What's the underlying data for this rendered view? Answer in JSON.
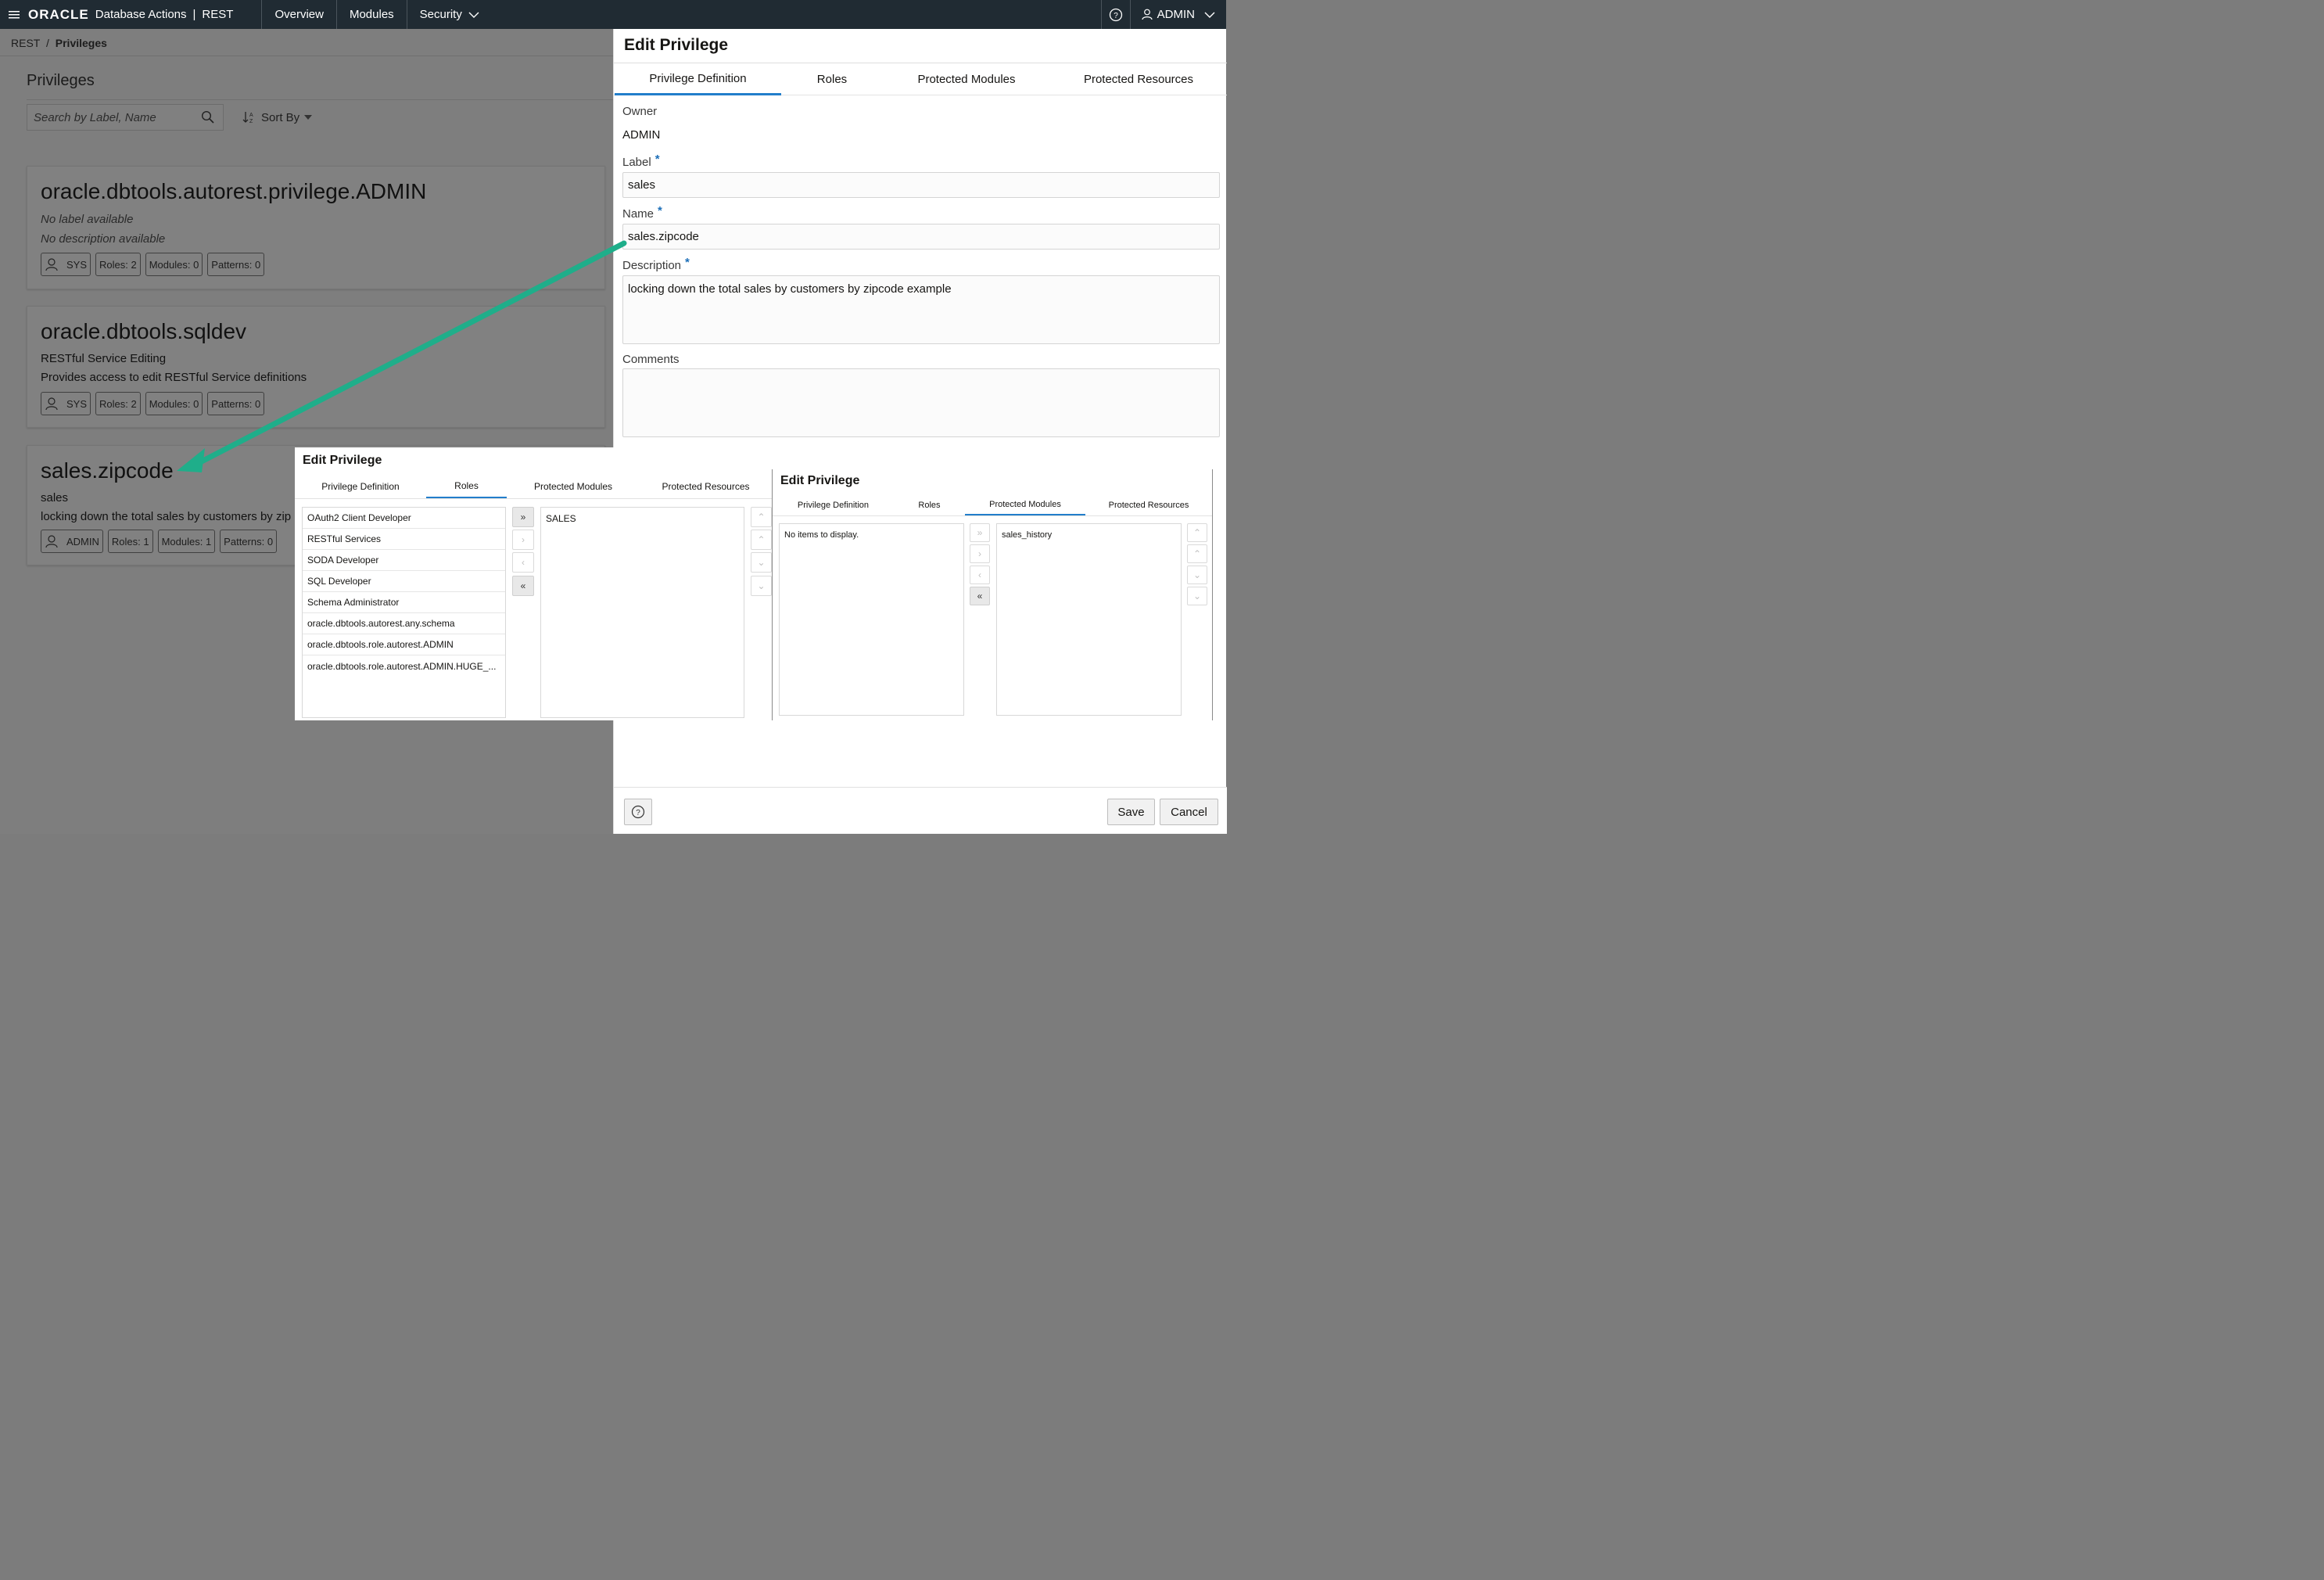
{
  "header": {
    "brand": "ORACLE",
    "app": "Database Actions",
    "separator": "|",
    "section": "REST",
    "nav": [
      "Overview",
      "Modules",
      "Security"
    ],
    "user": "ADMIN",
    "bg_color": "#202b33"
  },
  "breadcrumb": {
    "root": "REST",
    "sep": "/",
    "current": "Privileges"
  },
  "page": {
    "title": "Privileges",
    "search_placeholder": "Search by Label, Name",
    "sort_label": "Sort By"
  },
  "cards": [
    {
      "title": "oracle.dbtools.autorest.privilege.ADMIN",
      "label": "No label available",
      "description": "No description available",
      "owner": "SYS",
      "roles": "Roles: 2",
      "modules": "Modules: 0",
      "patterns": "Patterns: 0"
    },
    {
      "title": "oracle.dbtools.sqldev",
      "label": "RESTful Service Editing",
      "description": "Provides access to edit RESTful Service definitions",
      "owner": "SYS",
      "roles": "Roles: 2",
      "modules": "Modules: 0",
      "patterns": "Patterns: 0"
    },
    {
      "title": "sales.zipcode",
      "label": "sales",
      "description": "locking down the total sales by customers by zipc",
      "owner": "ADMIN",
      "roles": "Roles: 1",
      "modules": "Modules: 1",
      "patterns": "Patterns: 0"
    }
  ],
  "drawer": {
    "title": "Edit Privilege",
    "tabs": [
      "Privilege Definition",
      "Roles",
      "Protected Modules",
      "Protected Resources"
    ],
    "active_tab": "Privilege Definition",
    "owner_label": "Owner",
    "owner_value": "ADMIN",
    "label_label": "Label",
    "label_value": "sales",
    "name_label": "Name",
    "name_value": "sales.zipcode",
    "description_label": "Description",
    "description_value": "locking down the total sales by customers by zipcode example",
    "comments_label": "Comments",
    "comments_value": "",
    "required_mark": "*",
    "save_label": "Save",
    "cancel_label": "Cancel"
  },
  "roles_dialog": {
    "title": "Edit Privilege",
    "tabs": [
      "Privilege Definition",
      "Roles",
      "Protected Modules",
      "Protected Resources"
    ],
    "active_tab": "Roles",
    "available": [
      "OAuth2 Client Developer",
      "RESTful Services",
      "SODA Developer",
      "SQL Developer",
      "Schema Administrator",
      "oracle.dbtools.autorest.any.schema",
      "oracle.dbtools.role.autorest.ADMIN",
      "oracle.dbtools.role.autorest.ADMIN.HUGE_..."
    ],
    "selected": [
      "SALES"
    ]
  },
  "modules_dialog": {
    "title": "Edit Privilege",
    "tabs": [
      "Privilege Definition",
      "Roles",
      "Protected Modules",
      "Protected Resources"
    ],
    "active_tab": "Protected Modules",
    "available_empty": "No items to display.",
    "selected": [
      "sales_history"
    ]
  },
  "colors": {
    "accent": "#227ecb",
    "arrow": "#1fae8a",
    "required": "#1d6fb8"
  }
}
